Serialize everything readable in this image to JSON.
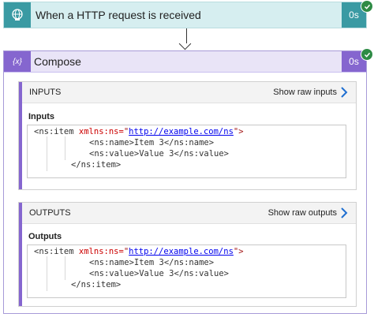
{
  "trigger": {
    "title": "When a HTTP request is received",
    "duration": "0s",
    "icon": "globe-request-icon",
    "status": "succeeded",
    "color": "#3a9aa3"
  },
  "compose": {
    "title": "Compose",
    "duration": "0s",
    "icon": "braces-icon",
    "icon_text": "{x}",
    "status": "succeeded",
    "color": "#8566cf"
  },
  "inputs": {
    "header": "INPUTS",
    "show_raw": "Show raw inputs",
    "field_label": "Inputs",
    "code": {
      "line1_open": "<ns:item ",
      "line1_attr": "xmlns:ns=",
      "line1_quote_open": "\"",
      "line1_url": "http://example.com/ns",
      "line1_quote_close": "\">",
      "line2": "<ns:name>Item 3</ns:name>",
      "line3": "<ns:value>Value 3</ns:value>",
      "line4": "</ns:item>"
    }
  },
  "outputs": {
    "header": "OUTPUTS",
    "show_raw": "Show raw outputs",
    "field_label": "Outputs",
    "code": {
      "line1_open": "<ns:item ",
      "line1_attr": "xmlns:ns=",
      "line1_quote_open": "\"",
      "line1_url": "http://example.com/ns",
      "line1_quote_close": "\">",
      "line2": "<ns:name>Item 3</ns:name>",
      "line3": "<ns:value>Value 3</ns:value>",
      "line4": "</ns:item>"
    }
  },
  "colors": {
    "success": "#2e8b45",
    "link": "#0000ee",
    "accent": "#8566cf"
  }
}
